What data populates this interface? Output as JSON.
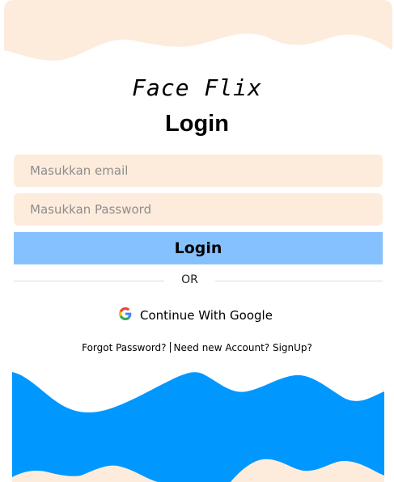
{
  "app": {
    "logo_text": "Face Flix",
    "heading": "Login"
  },
  "form": {
    "email_placeholder": "Masukkan email",
    "password_placeholder": "Masukkan Password",
    "submit_label": "Login"
  },
  "divider": {
    "label": "OR"
  },
  "google": {
    "label": "Continue With Google",
    "icon": "google-icon"
  },
  "links": {
    "forgot": "Forgot Password?",
    "signup": "Need new Account? SignUp?"
  },
  "colors": {
    "peach": "#fdecdc",
    "button_blue": "#86c1ff",
    "wave_blue": "#0098ff",
    "top_wave": "#fdecdc"
  }
}
